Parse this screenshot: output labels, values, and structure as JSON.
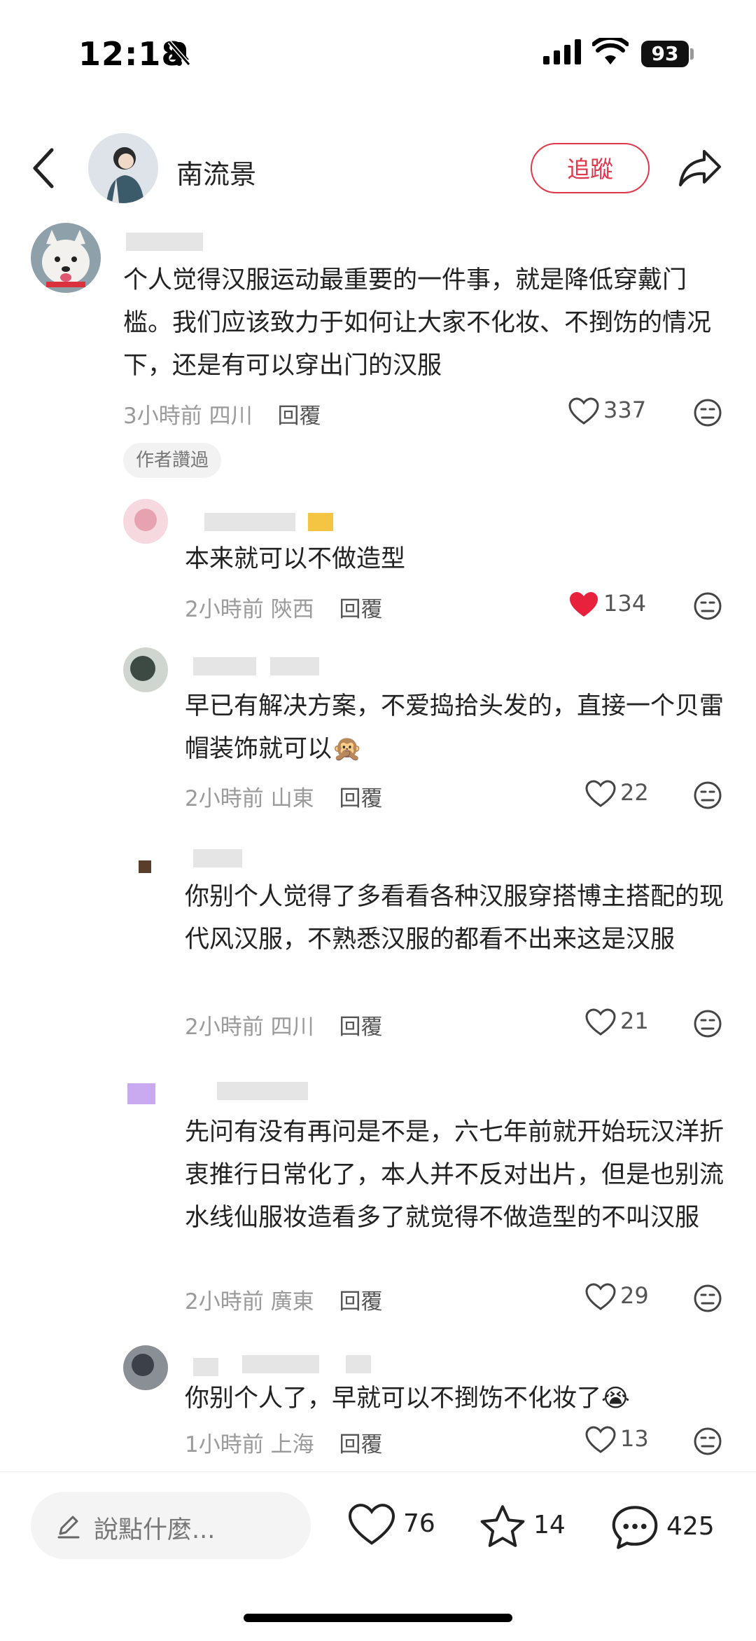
{
  "status": {
    "time": "12:18",
    "battery": "93"
  },
  "header": {
    "author_name": "南流景",
    "follow_label": "追蹤"
  },
  "comments": [
    {
      "text": "个人觉得汉服运动最重要的一件事，就是降低穿戴门槛。我们应该致力于如何让大家不化妆、不捯饬的情况下，还是有可以穿出门的汉服",
      "time": "3小時前",
      "location": "四川",
      "reply": "回覆",
      "likes": "337",
      "tag": "作者讚過"
    },
    {
      "text": "本来就可以不做造型",
      "time": "2小時前",
      "location": "陝西",
      "reply": "回覆",
      "likes": "134"
    },
    {
      "text": "早已有解决方案，不爱捣拾头发的，直接一个贝雷帽装饰就可以🙊",
      "time": "2小時前",
      "location": "山東",
      "reply": "回覆",
      "likes": "22"
    },
    {
      "text": "你别个人觉得了多看看各种汉服穿搭博主搭配的现代风汉服，不熟悉汉服的都看不出来这是汉服",
      "time": "2小時前",
      "location": "四川",
      "reply": "回覆",
      "likes": "21"
    },
    {
      "text": "先问有没有再问是不是，六七年前就开始玩汉洋折衷推行日常化了，本人并不反对出片，但是也别流水线仙服妆造看多了就觉得不做造型的不叫汉服",
      "time": "2小時前",
      "location": "廣東",
      "reply": "回覆",
      "likes": "29"
    },
    {
      "text": "你别个人了，早就可以不捯饬不化妆了😭",
      "time": "1小時前",
      "location": "上海",
      "reply": "回覆",
      "likes": "13"
    }
  ],
  "bottom": {
    "placeholder": "說點什麼...",
    "likes": "76",
    "stars": "14",
    "comments": "425"
  }
}
